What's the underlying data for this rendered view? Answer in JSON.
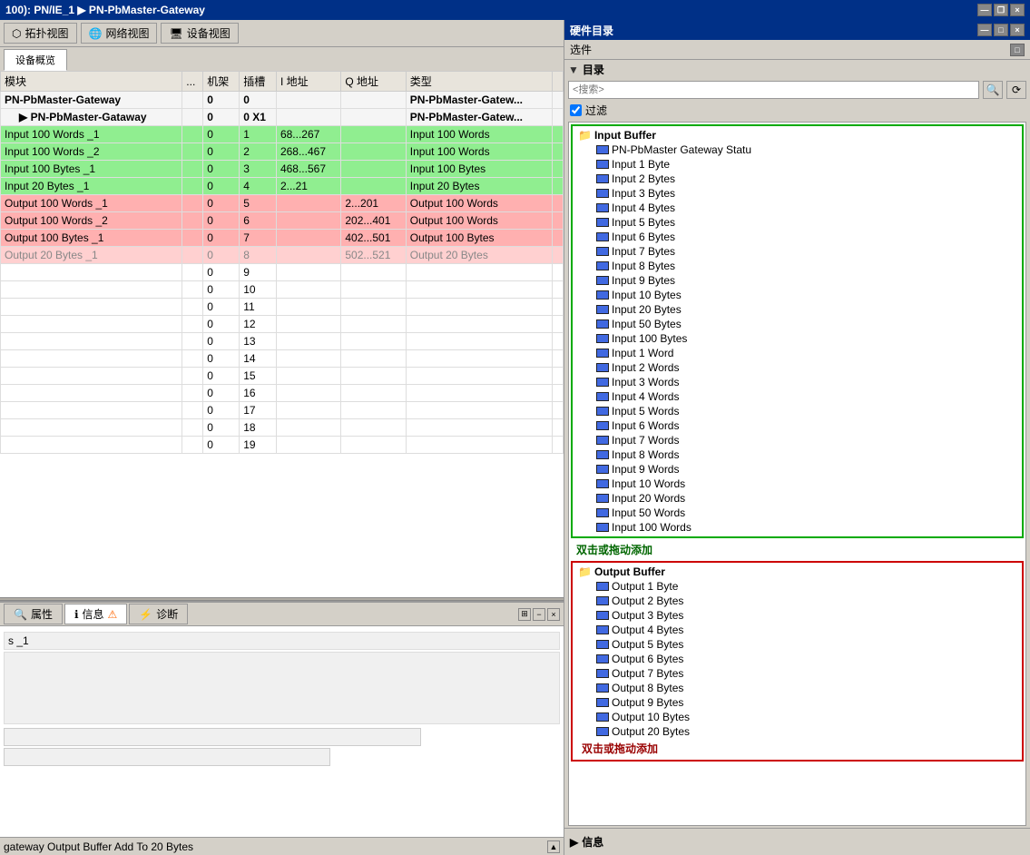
{
  "titlebar": {
    "title": "100): PN/IE_1 ▶ PN-PbMaster-Gateway",
    "close": "×",
    "maximize": "□",
    "minimize": "—",
    "restore": "❐"
  },
  "toolbar": {
    "topology_btn": "拓扑视图",
    "network_btn": "网络视图",
    "device_btn": "设备视图"
  },
  "device_tab": "设备概览",
  "table": {
    "headers": [
      "模块",
      "...",
      "机架",
      "插槽",
      "I 地址",
      "Q 地址",
      "类型"
    ],
    "rows": [
      {
        "module": "PN-PbMaster-Gateway",
        "dots": "",
        "rack": "0",
        "slot": "0",
        "iaddr": "",
        "qaddr": "",
        "type": "PN-PbMaster-Gatew...",
        "style": "module",
        "indent": 0
      },
      {
        "module": "PN-PbMaster-Gataway",
        "dots": "",
        "rack": "0",
        "slot": "0 X1",
        "iaddr": "",
        "qaddr": "",
        "type": "PN-PbMaster-Gatew...",
        "style": "module",
        "indent": 1
      },
      {
        "module": "Input 100 Words _1",
        "dots": "",
        "rack": "0",
        "slot": "1",
        "iaddr": "68...267",
        "qaddr": "",
        "type": "Input 100 Words",
        "style": "green",
        "indent": 0
      },
      {
        "module": "Input 100 Words _2",
        "dots": "",
        "rack": "0",
        "slot": "2",
        "iaddr": "268...467",
        "qaddr": "",
        "type": "Input 100 Words",
        "style": "green",
        "indent": 0
      },
      {
        "module": "Input 100 Bytes _1",
        "dots": "",
        "rack": "0",
        "slot": "3",
        "iaddr": "468...567",
        "qaddr": "",
        "type": "Input 100 Bytes",
        "style": "green",
        "indent": 0
      },
      {
        "module": "Input 20 Bytes _1",
        "dots": "",
        "rack": "0",
        "slot": "4",
        "iaddr": "2...21",
        "qaddr": "",
        "type": "Input 20 Bytes",
        "style": "green",
        "indent": 0
      },
      {
        "module": "Output 100 Words _1",
        "dots": "",
        "rack": "0",
        "slot": "5",
        "iaddr": "",
        "qaddr": "2...201",
        "type": "Output 100 Words",
        "style": "red",
        "indent": 0
      },
      {
        "module": "Output 100 Words _2",
        "dots": "",
        "rack": "0",
        "slot": "6",
        "iaddr": "",
        "qaddr": "202...401",
        "type": "Output 100 Words",
        "style": "red",
        "indent": 0
      },
      {
        "module": "Output 100 Bytes _1",
        "dots": "",
        "rack": "0",
        "slot": "7",
        "iaddr": "",
        "qaddr": "402...501",
        "type": "Output 100 Bytes",
        "style": "red",
        "indent": 0
      },
      {
        "module": "Output 20 Bytes _1",
        "dots": "",
        "rack": "0",
        "slot": "8",
        "iaddr": "",
        "qaddr": "502...521",
        "type": "Output 20 Bytes",
        "style": "red-light",
        "indent": 0
      },
      {
        "module": "",
        "dots": "",
        "rack": "0",
        "slot": "9",
        "iaddr": "",
        "qaddr": "",
        "type": "",
        "style": "normal",
        "indent": 0
      },
      {
        "module": "",
        "dots": "",
        "rack": "0",
        "slot": "10",
        "iaddr": "",
        "qaddr": "",
        "type": "",
        "style": "normal",
        "indent": 0
      },
      {
        "module": "",
        "dots": "",
        "rack": "0",
        "slot": "11",
        "iaddr": "",
        "qaddr": "",
        "type": "",
        "style": "normal",
        "indent": 0
      },
      {
        "module": "",
        "dots": "",
        "rack": "0",
        "slot": "12",
        "iaddr": "",
        "qaddr": "",
        "type": "",
        "style": "normal",
        "indent": 0
      },
      {
        "module": "",
        "dots": "",
        "rack": "0",
        "slot": "13",
        "iaddr": "",
        "qaddr": "",
        "type": "",
        "style": "normal",
        "indent": 0
      },
      {
        "module": "",
        "dots": "",
        "rack": "0",
        "slot": "14",
        "iaddr": "",
        "qaddr": "",
        "type": "",
        "style": "normal",
        "indent": 0
      },
      {
        "module": "",
        "dots": "",
        "rack": "0",
        "slot": "15",
        "iaddr": "",
        "qaddr": "",
        "type": "",
        "style": "normal",
        "indent": 0
      },
      {
        "module": "",
        "dots": "",
        "rack": "0",
        "slot": "16",
        "iaddr": "",
        "qaddr": "",
        "type": "",
        "style": "normal",
        "indent": 0
      },
      {
        "module": "",
        "dots": "",
        "rack": "0",
        "slot": "17",
        "iaddr": "",
        "qaddr": "",
        "type": "",
        "style": "normal",
        "indent": 0
      },
      {
        "module": "",
        "dots": "",
        "rack": "0",
        "slot": "18",
        "iaddr": "",
        "qaddr": "",
        "type": "",
        "style": "normal",
        "indent": 0
      },
      {
        "module": "",
        "dots": "",
        "rack": "0",
        "slot": "19",
        "iaddr": "",
        "qaddr": "",
        "type": "",
        "style": "normal",
        "indent": 0
      }
    ]
  },
  "bottom_tabs": {
    "properties": "属性",
    "info": "信息",
    "info_icon": "ℹ",
    "diagnostics": "诊断"
  },
  "bottom_content": {
    "row1": "s _1",
    "row2": ""
  },
  "status_bar": {
    "text": "gateway Output Buffer Add To 20 Bytes"
  },
  "right_panel": {
    "title": "硬件目录",
    "win_btns": [
      "—",
      "□",
      "×"
    ],
    "catalog_label": "选件",
    "directory_label": "目录",
    "search_placeholder": "<搜索>",
    "filter_label": "过滤",
    "filter_checked": true,
    "annotation_green": "双击或拖动添加",
    "annotation_red": "双击或拖动添加",
    "tree": {
      "input_buffer": {
        "label": "Input Buffer",
        "expanded": true,
        "items": [
          "PN-PbMaster Gateway Statu",
          "Input 1 Byte",
          "Input 2 Bytes",
          "Input 3 Bytes",
          "Input 4 Bytes",
          "Input 5 Bytes",
          "Input 6 Bytes",
          "Input 7 Bytes",
          "Input 8 Bytes",
          "Input 9 Bytes",
          "Input 10 Bytes",
          "Input 20 Bytes",
          "Input 50 Bytes",
          "Input 100 Bytes",
          "Input 1 Word",
          "Input 2 Words",
          "Input 3 Words",
          "Input 4 Words",
          "Input 5 Words",
          "Input 6 Words",
          "Input 7 Words",
          "Input 8 Words",
          "Input 9 Words",
          "Input 10 Words",
          "Input 20 Words",
          "Input 50 Words",
          "Input 100 Words"
        ]
      },
      "output_buffer": {
        "label": "Output Buffer",
        "expanded": true,
        "items": [
          "Output 1 Byte",
          "Output 2 Bytes",
          "Output 3 Bytes",
          "Output 4 Bytes",
          "Output 5 Bytes",
          "Output 6 Bytes",
          "Output 7 Bytes",
          "Output 8 Bytes",
          "Output 9 Bytes",
          "Output 10 Bytes",
          "Output 20 Bytes"
        ]
      }
    },
    "info_label": "信息"
  }
}
